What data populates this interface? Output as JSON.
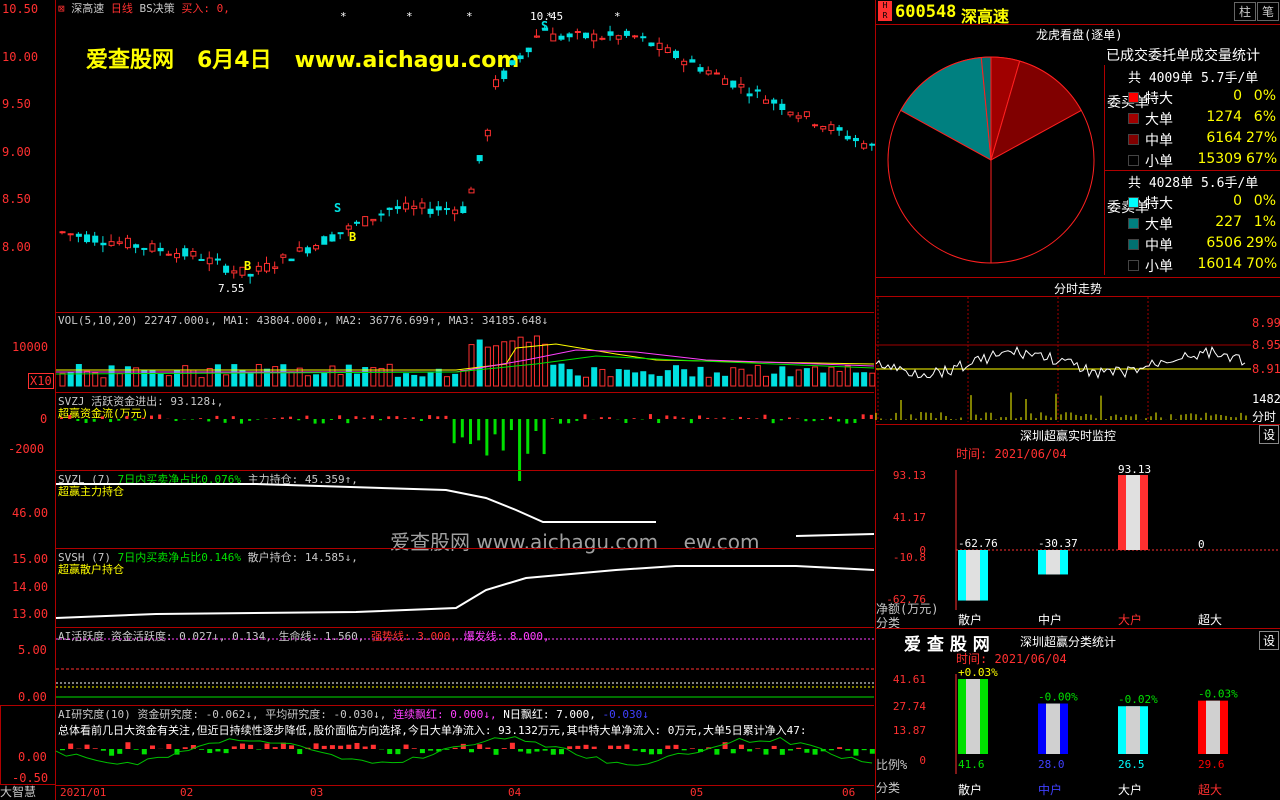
{
  "stock": {
    "name": "深高速",
    "period": "日线",
    "indicator": "BS决策",
    "signal": "买入: 0,"
  },
  "watermark": {
    "site": "爱查股网",
    "date": "6月4日",
    "url": "www.aichagu.com",
    "center_url": "爱查股网  www.aichagu.com",
    "center_tail": "ew.com"
  },
  "price_axis": [
    "10.50",
    "10.00",
    "9.50",
    "9.00",
    "8.50",
    "8.00"
  ],
  "price_marks": {
    "high": "10.45",
    "low": "7.55",
    "s": "S",
    "b": "B"
  },
  "vol": {
    "header": "VOL(5,10,20) 22747.000↓, MA1: 43804.000↓, MA2: 36776.699↑, MA3: 34185.648↓",
    "axis": "10000",
    "unit": "X10"
  },
  "svzj": {
    "header": "SVZJ  活跃资金进出: 93.128↓,",
    "sub": "超赢资金流(万元)",
    "axis": [
      "0",
      "-2000"
    ]
  },
  "svzl": {
    "header": "SVZL (7)",
    "mid": "7日内买卖净占比0.076%",
    "tail": "主力持仓: 45.359↑,",
    "sub": "超赢主力持仓",
    "axis": "46.00"
  },
  "svsh": {
    "header": "SVSH (7)",
    "mid": "7日内买卖净占比0.146%",
    "tail": "散户持仓: 14.585↓,",
    "sub": "超赢散户持仓",
    "axis": [
      "15.00",
      "14.00",
      "13.00"
    ]
  },
  "ai": {
    "h1": "AI活跃度 资金活跃度: 0.027↓, 0.134, 生命线: 1.560,",
    "h2": "强势线: 3.000,",
    "h3": "爆发线: 8.000,",
    "axis": [
      "5.00",
      "0.00"
    ]
  },
  "air": {
    "h1": "AI研究度(10) 资金研究度: -0.062↓, 平均研究度: -0.030↓,",
    "h2": "连续飘红: 0.000↓,",
    "h3": "N日飘红: 7.000,",
    "h4": "-0.030↓",
    "desc": "总体看前几日大资金有关注,但近日持续性逐步降低,股价面临方向选择,今日大单净流入: 93.132万元,其中特大单净流入: 0万元,大单5日累计净入47:",
    "axis": [
      "0.00",
      "-0.50"
    ]
  },
  "xaxis": [
    "2021/01",
    "02",
    "03",
    "04",
    "05",
    "06"
  ],
  "footer": "大智慧",
  "right": {
    "code": "600548",
    "name": "深高速",
    "btn1": "柱",
    "btn2": "笔",
    "title": "龙虎看盘(逐单)",
    "subtitle": "已成交委托单成交量统计",
    "buy": {
      "label": "委买单",
      "total": "共 4009单 5.7手/单",
      "rows": [
        [
          "特大",
          "0",
          "0%"
        ],
        [
          "大单",
          "1274",
          "6%"
        ],
        [
          "中单",
          "6164",
          "27%"
        ],
        [
          "小单",
          "15309",
          "67%"
        ]
      ]
    },
    "sell": {
      "label": "委卖单",
      "total": "共 4028单 5.6手/单",
      "rows": [
        [
          "特大",
          "0",
          "0%"
        ],
        [
          "大单",
          "227",
          "1%"
        ],
        [
          "中单",
          "6506",
          "29%"
        ],
        [
          "小单",
          "16014",
          "70%"
        ]
      ]
    },
    "colors": {
      "buy": [
        "#ff0000",
        "#a00000",
        "#800000",
        "#000000"
      ],
      "sell": [
        "#00ffff",
        "#008080",
        "#007070",
        "#000000"
      ]
    },
    "fenshi": {
      "title": "分时走势",
      "axis": [
        "8.99",
        "8.95",
        "8.91"
      ],
      "vol": "1482",
      "vlabel": "分时"
    },
    "monitor": {
      "title": "深圳超赢实时监控",
      "btn": "设",
      "time": "时间: 2021/06/04",
      "axis": [
        "93.13",
        "41.17",
        "0",
        "-10.8",
        "-62.76"
      ],
      "vals": [
        "-62.76",
        "-30.37",
        "93.13",
        "0"
      ],
      "unit": "净额(万元)",
      "cat": "分类",
      "labels": [
        "散户",
        "中户",
        "大户",
        "超大"
      ],
      "values": [
        -62.76,
        -30.37,
        93.13,
        0
      ]
    },
    "cls": {
      "brand": "爱 查 股 网",
      "title": "深圳超赢分类统计",
      "btn": "设",
      "time": "时间: 2021/06/04",
      "axis": [
        "41.61",
        "27.74",
        "13.87",
        "0"
      ],
      "pct": [
        "+0.03%",
        "-0.00%",
        "-0.02%",
        "-0.03%"
      ],
      "vals": [
        "41.6",
        "28.0",
        "26.5",
        "29.6"
      ],
      "values": [
        41.6,
        28.0,
        26.5,
        29.6
      ],
      "ratio": "比例%",
      "cat": "分类",
      "labels": [
        "散户",
        "中户",
        "大户",
        "超大"
      ]
    }
  }
}
